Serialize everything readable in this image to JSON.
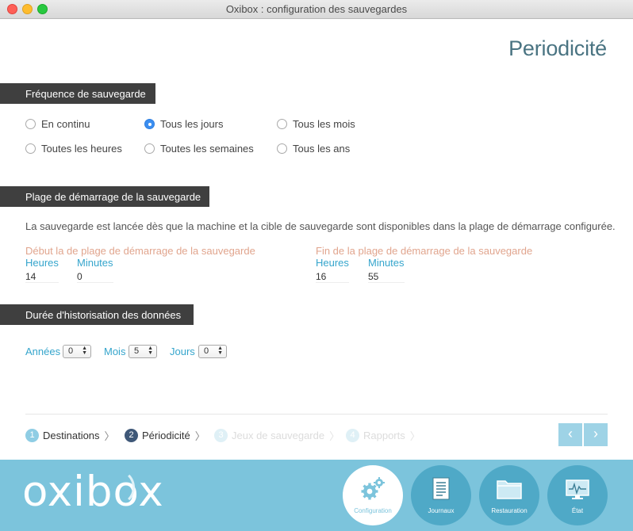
{
  "window": {
    "title": "Oxibox : configuration des sauvegardes"
  },
  "page": {
    "heading": "Periodicité"
  },
  "frequency": {
    "header": "Fréquence de sauvegarde",
    "options": [
      {
        "label": "En continu",
        "checked": false
      },
      {
        "label": "Tous les jours",
        "checked": true
      },
      {
        "label": "Tous les mois",
        "checked": false
      },
      {
        "label": "Toutes les heures",
        "checked": false
      },
      {
        "label": "Toutes les semaines",
        "checked": false
      },
      {
        "label": "Tous les ans",
        "checked": false
      }
    ]
  },
  "start_range": {
    "header": "Plage de démarrage de la sauvegarde",
    "description": "La sauvegarde est lancée dès que la machine et la cible de sauvegarde sont disponibles dans la plage de démarrage configurée.",
    "start": {
      "title": "Début la de plage de démarrage de la sauvegarde",
      "hours_label": "Heures",
      "minutes_label": "Minutes",
      "hours": "14",
      "minutes": "0"
    },
    "end": {
      "title": "Fin de la plage de démarrage de la sauvegarde",
      "hours_label": "Heures",
      "minutes_label": "Minutes",
      "hours": "16",
      "minutes": "55"
    }
  },
  "retention": {
    "header": "Durée d'historisation des données",
    "years_label": "Années",
    "years": "0",
    "months_label": "Mois",
    "months": "5",
    "days_label": "Jours",
    "days": "0"
  },
  "steps": [
    {
      "num": "1",
      "label": "Destinations",
      "state": "done"
    },
    {
      "num": "2",
      "label": "Périodicité",
      "state": "active"
    },
    {
      "num": "3",
      "label": "Jeux de sauvegarde",
      "state": "future"
    },
    {
      "num": "4",
      "label": "Rapports",
      "state": "future"
    }
  ],
  "nav": {
    "prev": "‹",
    "next": "›"
  },
  "footer": {
    "logo": "oxibox",
    "buttons": [
      {
        "label": "Configuration",
        "icon": "gears-icon",
        "active": true
      },
      {
        "label": "Journaux",
        "icon": "document-icon",
        "active": false
      },
      {
        "label": "Restauration",
        "icon": "folder-icon",
        "active": false
      },
      {
        "label": "État",
        "icon": "monitor-icon",
        "active": false
      }
    ]
  },
  "colors": {
    "accent": "#35a5cc",
    "header_bg": "#3f3f3f",
    "footer_bg": "#7cc4dc",
    "range_title": "#e1a58e"
  }
}
